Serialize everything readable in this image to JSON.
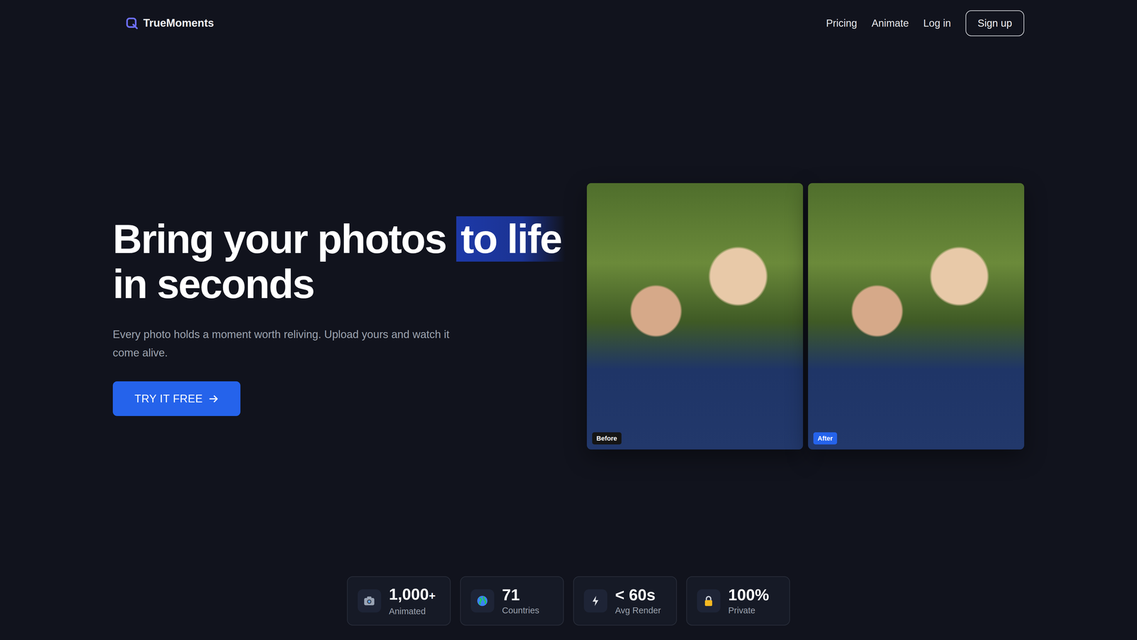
{
  "brand": {
    "name": "TrueMoments"
  },
  "nav": {
    "links": [
      "Pricing",
      "Animate",
      "Log in"
    ],
    "signup": "Sign up"
  },
  "hero": {
    "title_start": "Bring your photos ",
    "title_highlight": "to life",
    "title_end": "in seconds",
    "subtitle": "Every photo holds a moment worth reliving. Upload yours and watch it come alive.",
    "cta": "TRY IT FREE"
  },
  "comparison": [
    {
      "label": "Before",
      "kind": "before"
    },
    {
      "label": "After",
      "kind": "after"
    }
  ],
  "stats": [
    {
      "value": "1,000",
      "suffix": "+",
      "label": "Animated"
    },
    {
      "value": "71",
      "suffix": "",
      "label": "Countries"
    },
    {
      "value": "< 60s",
      "suffix": "",
      "label": "Avg Render"
    },
    {
      "value": "100%",
      "suffix": "",
      "label": "Private"
    }
  ]
}
